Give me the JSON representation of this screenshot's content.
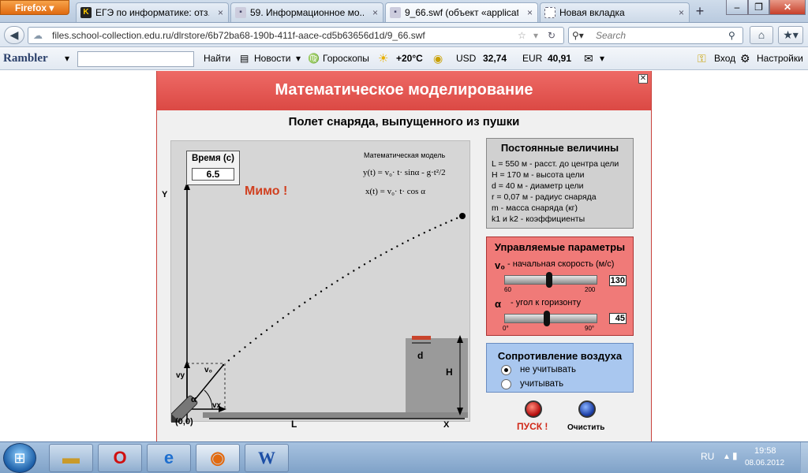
{
  "browser": {
    "app_button": "Firefox",
    "tabs": [
      {
        "icon": "K",
        "title": "ЕГЭ по информатике: отз..."
      },
      {
        "icon": "",
        "title": "59. Информационное мо..."
      },
      {
        "icon": "",
        "title": "9_66.swf (объект «applicat..."
      },
      {
        "icon": "",
        "title": "Новая вкладка"
      }
    ],
    "new_tab": "+",
    "url": "files.school-collection.edu.ru/dlrstore/6b72ba68-190b-411f-aace-cd5b63656d1d/9_66.swf",
    "search_placeholder": "Search"
  },
  "rambler": {
    "logo": "Rambler",
    "find": "Найти",
    "news": "Новости",
    "horoscopes": "Гороскопы",
    "temperature": "+20°C",
    "usd_label": "USD",
    "usd_value": "32,74",
    "eur_label": "EUR",
    "eur_value": "40,91",
    "login": "Вход",
    "settings": "Настройки"
  },
  "app": {
    "title": "Математическое моделирование",
    "subtitle": "Полет снаряда, выпущенного из пушки",
    "time_label": "Время (с)",
    "time_value": "6.5",
    "result": "Мимо !",
    "model_title": "Математическая модель",
    "formula_y": "y(t) = v₀· t· sinα - g·t²/2",
    "formula_x": "x(t) = v₀· t· cos α",
    "axis_y": "Y",
    "axis_x": "X",
    "origin": "(0,0)",
    "label_L": "L",
    "label_H": "H",
    "label_d": "d",
    "label_vy": "vy",
    "label_vx": "vx",
    "label_v0": "v₀",
    "label_alpha": "α"
  },
  "constants": {
    "header": "Постоянные величины",
    "lines": [
      "L = 550 м - расст. до центра цели",
      "H = 170 м  -   высота  цели",
      "d = 40 м   -   диаметр цели",
      "r = 0,07 м   -   радиус  снаряда",
      "m  -  масса  снаряда  (кг)",
      "k1  и  k2  -  коэффициенты"
    ]
  },
  "params": {
    "header": "Управляемые параметры",
    "v0_symbol": "v₀",
    "v0_label": "- начальная скорость (м/с)",
    "v0_min": "60",
    "v0_max": "200",
    "v0_value": "130",
    "alpha_symbol": "α",
    "alpha_label": "- угол к горизонту",
    "alpha_min": "0°",
    "alpha_max": "90°",
    "alpha_value": "45"
  },
  "air": {
    "header": "Сопротивление воздуха",
    "option1": "не учитывать",
    "option2": "учитывать",
    "selected": "не учитывать"
  },
  "buttons": {
    "launch": "ПУСК !",
    "clear": "Очистить"
  },
  "taskbar": {
    "lang": "RU",
    "time": "19:58",
    "date": "08.06.2012"
  },
  "colors": {
    "banner": "#db4944",
    "result": "#d04020",
    "controls_bg": "#f07a78",
    "air_bg": "#a9c7ef"
  }
}
